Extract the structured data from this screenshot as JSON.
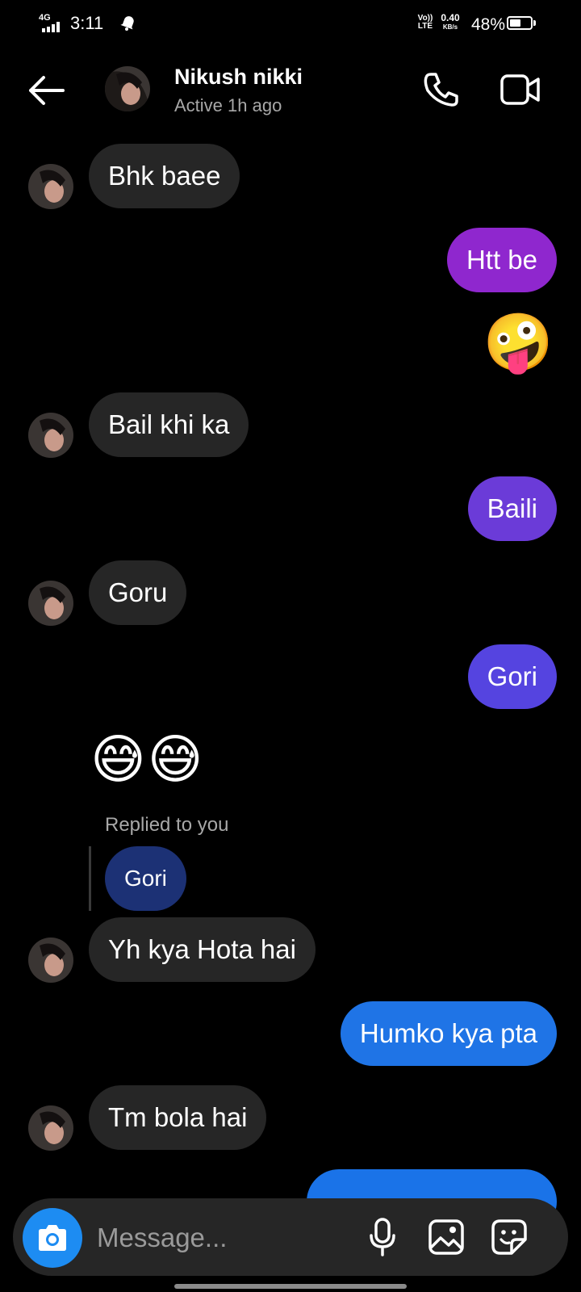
{
  "status_bar": {
    "network": "4G",
    "time": "3:11",
    "volte_top": "Vo))",
    "volte_bottom": "LTE",
    "speed_value": "0.40",
    "speed_unit": "KB/s",
    "battery": "48%",
    "battery_level": 0.48
  },
  "header": {
    "name": "Nikush nikki",
    "status": "Active 1h ago"
  },
  "messages": [
    {
      "text": "Bhk baee",
      "direction": "in"
    },
    {
      "text": "Htt be",
      "direction": "out",
      "color": "#8f27ce"
    },
    {
      "emoji": "🤪",
      "direction": "out"
    },
    {
      "text": "Bail khi ka",
      "direction": "in"
    },
    {
      "text": "Baili",
      "direction": "out",
      "color": "#6b3bd8"
    },
    {
      "text": "Goru",
      "direction": "in"
    },
    {
      "text": "Gori",
      "direction": "out",
      "color": "#5544e0"
    },
    {
      "emoji": "😅😅",
      "direction": "in"
    },
    {
      "reply_label": "Replied to you",
      "quoted": "Gori",
      "quoted_color": "#1c3175"
    },
    {
      "text": "Yh kya Hota hai",
      "direction": "in"
    },
    {
      "text": "Humko kya pta",
      "direction": "out",
      "color": "#1f74e6"
    },
    {
      "text": "Tm bola hai",
      "direction": "in"
    }
  ],
  "composer": {
    "placeholder": "Message..."
  },
  "icons": {
    "back": "back-arrow-icon",
    "call": "phone-icon",
    "video": "video-camera-icon",
    "camera": "camera-icon",
    "mic": "microphone-icon",
    "gallery": "gallery-icon",
    "sticker": "sticker-icon"
  }
}
